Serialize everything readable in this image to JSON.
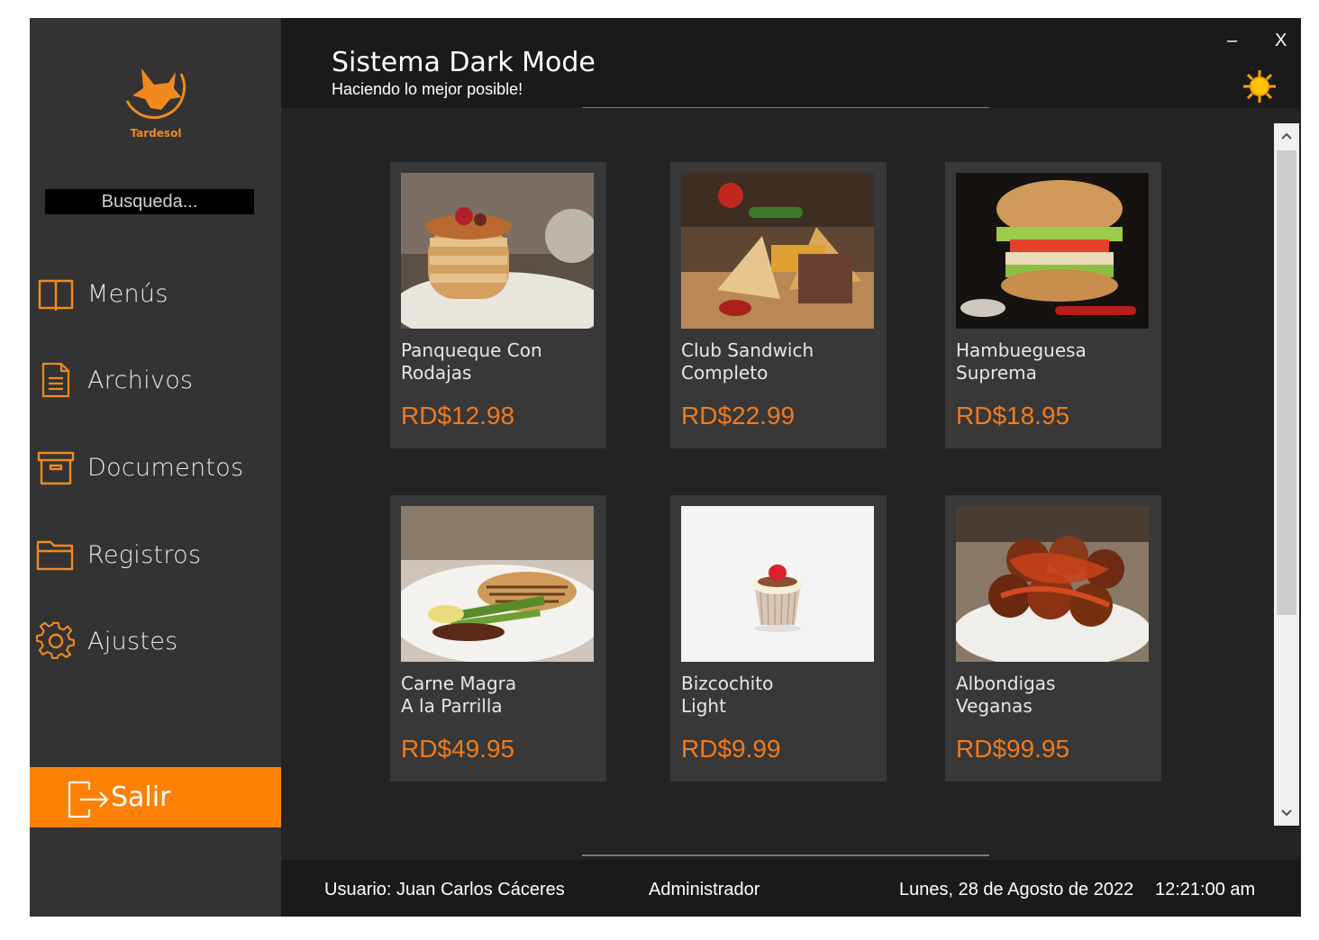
{
  "sidebar": {
    "logo_text": "Tardesol",
    "search_placeholder": "Busqueda...",
    "items": [
      {
        "label": "Menús",
        "icon": "book-icon"
      },
      {
        "label": "Archivos",
        "icon": "file-icon"
      },
      {
        "label": "Documentos",
        "icon": "archive-box-icon"
      },
      {
        "label": "Registros",
        "icon": "folder-icon"
      },
      {
        "label": "Ajustes",
        "icon": "gear-icon"
      }
    ],
    "exit_label": "Salir"
  },
  "header": {
    "title": "Sistema Dark Mode",
    "subtitle": "Haciendo lo mejor posible!",
    "minimize": "–",
    "close": "X"
  },
  "products": [
    {
      "line1": "Panqueque Con",
      "line2": "Rodajas",
      "price": "RD$12.98"
    },
    {
      "line1": "Club Sandwich",
      "line2": "Completo",
      "price": "RD$22.99"
    },
    {
      "line1": "Hambueguesa",
      "line2": "Suprema",
      "price": "RD$18.95"
    },
    {
      "line1": "Carne Magra",
      "line2": "A la Parrilla",
      "price": "RD$49.95"
    },
    {
      "line1": "Bizcochito",
      "line2": "Light",
      "price": "RD$9.99"
    },
    {
      "line1": "Albondigas",
      "line2": "Veganas",
      "price": "RD$99.95"
    }
  ],
  "footer": {
    "user": "Usuario: Juan Carlos Cáceres",
    "role": "Administrador",
    "date": "Lunes, 28 de Agosto de 2022",
    "time": "12:21:00 am"
  },
  "colors": {
    "accent": "#fd8106",
    "price": "#f07a1a",
    "sidebar_bg": "#333333",
    "content_bg": "#232323",
    "header_bg": "#1a1a1a",
    "card_bg": "#383838"
  }
}
